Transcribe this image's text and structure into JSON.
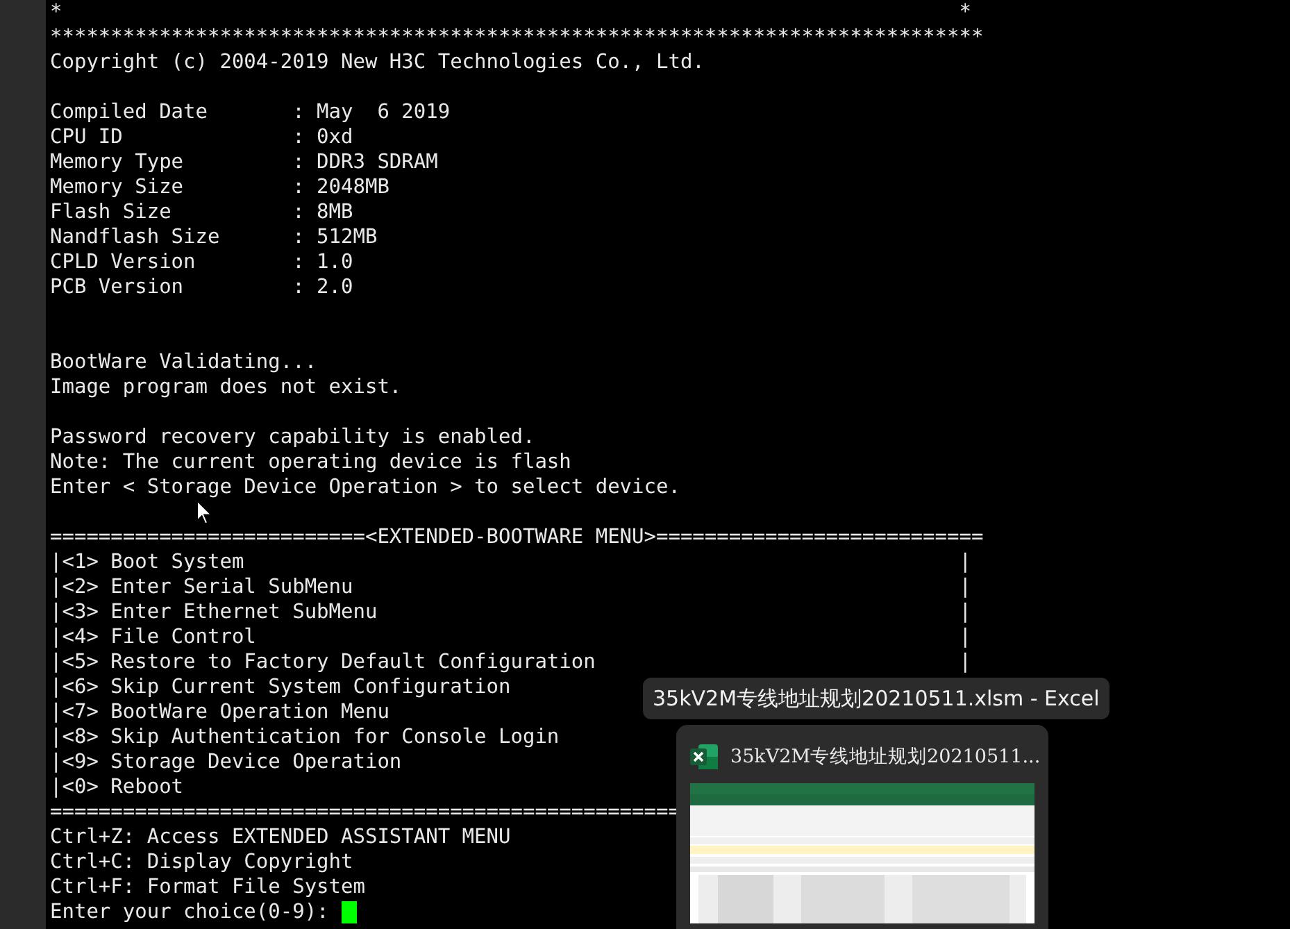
{
  "terminal": {
    "lines": [
      {
        "kind": "edges",
        "left": "*",
        "right": "*"
      },
      {
        "kind": "text",
        "text": "*****************************************************************************"
      },
      {
        "kind": "text",
        "text": "Copyright (c) 2004-2019 New H3C Technologies Co., Ltd."
      },
      {
        "kind": "blank"
      },
      {
        "kind": "text",
        "text": "Compiled Date       : May  6 2019"
      },
      {
        "kind": "text",
        "text": "CPU ID              : 0xd"
      },
      {
        "kind": "text",
        "text": "Memory Type         : DDR3 SDRAM"
      },
      {
        "kind": "text",
        "text": "Memory Size         : 2048MB"
      },
      {
        "kind": "text",
        "text": "Flash Size          : 8MB"
      },
      {
        "kind": "text",
        "text": "Nandflash Size      : 512MB"
      },
      {
        "kind": "text",
        "text": "CPLD Version        : 1.0"
      },
      {
        "kind": "text",
        "text": "PCB Version         : 2.0"
      },
      {
        "kind": "blank"
      },
      {
        "kind": "blank"
      },
      {
        "kind": "text",
        "text": "BootWare Validating..."
      },
      {
        "kind": "text",
        "text": "Image program does not exist."
      },
      {
        "kind": "blank"
      },
      {
        "kind": "text",
        "text": "Password recovery capability is enabled."
      },
      {
        "kind": "text",
        "text": "Note: The current operating device is flash"
      },
      {
        "kind": "text",
        "text": "Enter < Storage Device Operation > to select device."
      },
      {
        "kind": "blank"
      },
      {
        "kind": "text",
        "text": "==========================<EXTENDED-BOOTWARE MENU>==========================="
      },
      {
        "kind": "menu",
        "text": "|<1> Boot System",
        "edge": "|"
      },
      {
        "kind": "menu",
        "text": "|<2> Enter Serial SubMenu",
        "edge": "|"
      },
      {
        "kind": "menu",
        "text": "|<3> Enter Ethernet SubMenu",
        "edge": "|"
      },
      {
        "kind": "menu",
        "text": "|<4> File Control",
        "edge": "|"
      },
      {
        "kind": "menu",
        "text": "|<5> Restore to Factory Default Configuration",
        "edge": "|"
      },
      {
        "kind": "menu",
        "text": "|<6> Skip Current System Configuration"
      },
      {
        "kind": "menu",
        "text": "|<7> BootWare Operation Menu"
      },
      {
        "kind": "menu",
        "text": "|<8> Skip Authentication for Console Login"
      },
      {
        "kind": "menu",
        "text": "|<9> Storage Device Operation"
      },
      {
        "kind": "menu",
        "text": "|<0> Reboot"
      },
      {
        "kind": "text",
        "text": "===================================================="
      },
      {
        "kind": "text",
        "text": "Ctrl+Z: Access EXTENDED ASSISTANT MENU"
      },
      {
        "kind": "text",
        "text": "Ctrl+C: Display Copyright"
      },
      {
        "kind": "text",
        "text": "Ctrl+F: Format File System"
      },
      {
        "kind": "prompt",
        "text": "Enter your choice(0-9):",
        "cursor": true
      }
    ]
  },
  "tooltip": {
    "text": "35kV2M专线地址规划20210511.xlsm - Excel"
  },
  "preview": {
    "title": "35kV2M专线地址规划20210511..."
  }
}
